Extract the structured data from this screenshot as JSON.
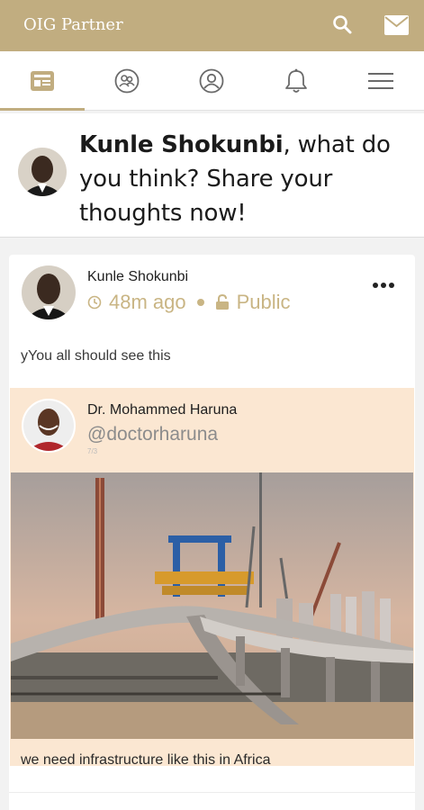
{
  "app": {
    "title": "OIG  Partner"
  },
  "header_icons": [
    "search-icon",
    "mail-icon"
  ],
  "nav": {
    "items": [
      {
        "name": "home-feed-icon",
        "active": true
      },
      {
        "name": "groups-icon",
        "active": false
      },
      {
        "name": "profile-icon",
        "active": false
      },
      {
        "name": "notifications-bell-icon",
        "active": false
      },
      {
        "name": "menu-hamburger-icon",
        "active": false
      }
    ]
  },
  "composer": {
    "user_name": "Kunle Shokunbi",
    "prompt": ", what do you think? Share your thoughts now!"
  },
  "post": {
    "author": "Kunle Shokunbi",
    "time": "48m ago",
    "visibility": "Public",
    "text": "yYou all should see this",
    "shared": {
      "author": "Dr. Mohammed Haruna",
      "handle": "@doctorharuna",
      "sub": "7/3",
      "caption": "we need infrastructure like this in Africa"
    }
  },
  "colors": {
    "brand": "#c1ad80",
    "meta": "#c9b584",
    "shared_bg": "#fbe7d2"
  }
}
